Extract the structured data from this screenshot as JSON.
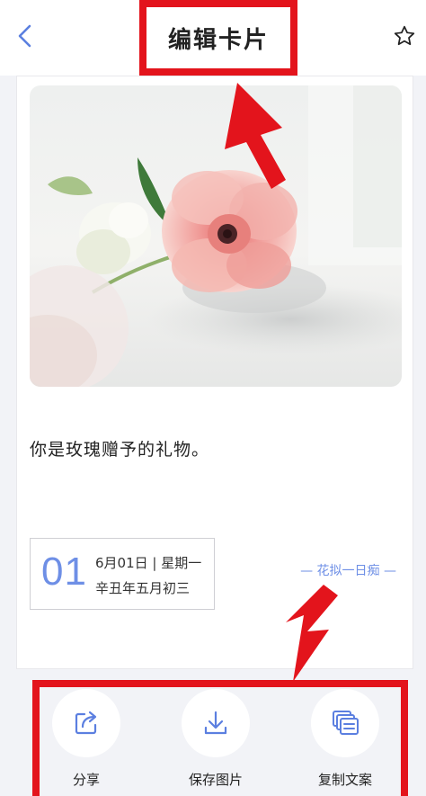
{
  "header": {
    "title": "编辑卡片"
  },
  "card": {
    "quote": "你是玫瑰赠予的礼物。",
    "date": {
      "day": "01",
      "line1": "6月01日 | 星期一",
      "line2": "辛丑年五月初三"
    },
    "signature": "— 花拟一日痴 —"
  },
  "actions": [
    {
      "label": "分享",
      "icon": "share-icon"
    },
    {
      "label": "保存图片",
      "icon": "download-icon"
    },
    {
      "label": "复制文案",
      "icon": "copy-icon"
    }
  ],
  "colors": {
    "accent": "#6e8fe6",
    "highlight": "#e3141c",
    "background": "#f2f3f7"
  }
}
